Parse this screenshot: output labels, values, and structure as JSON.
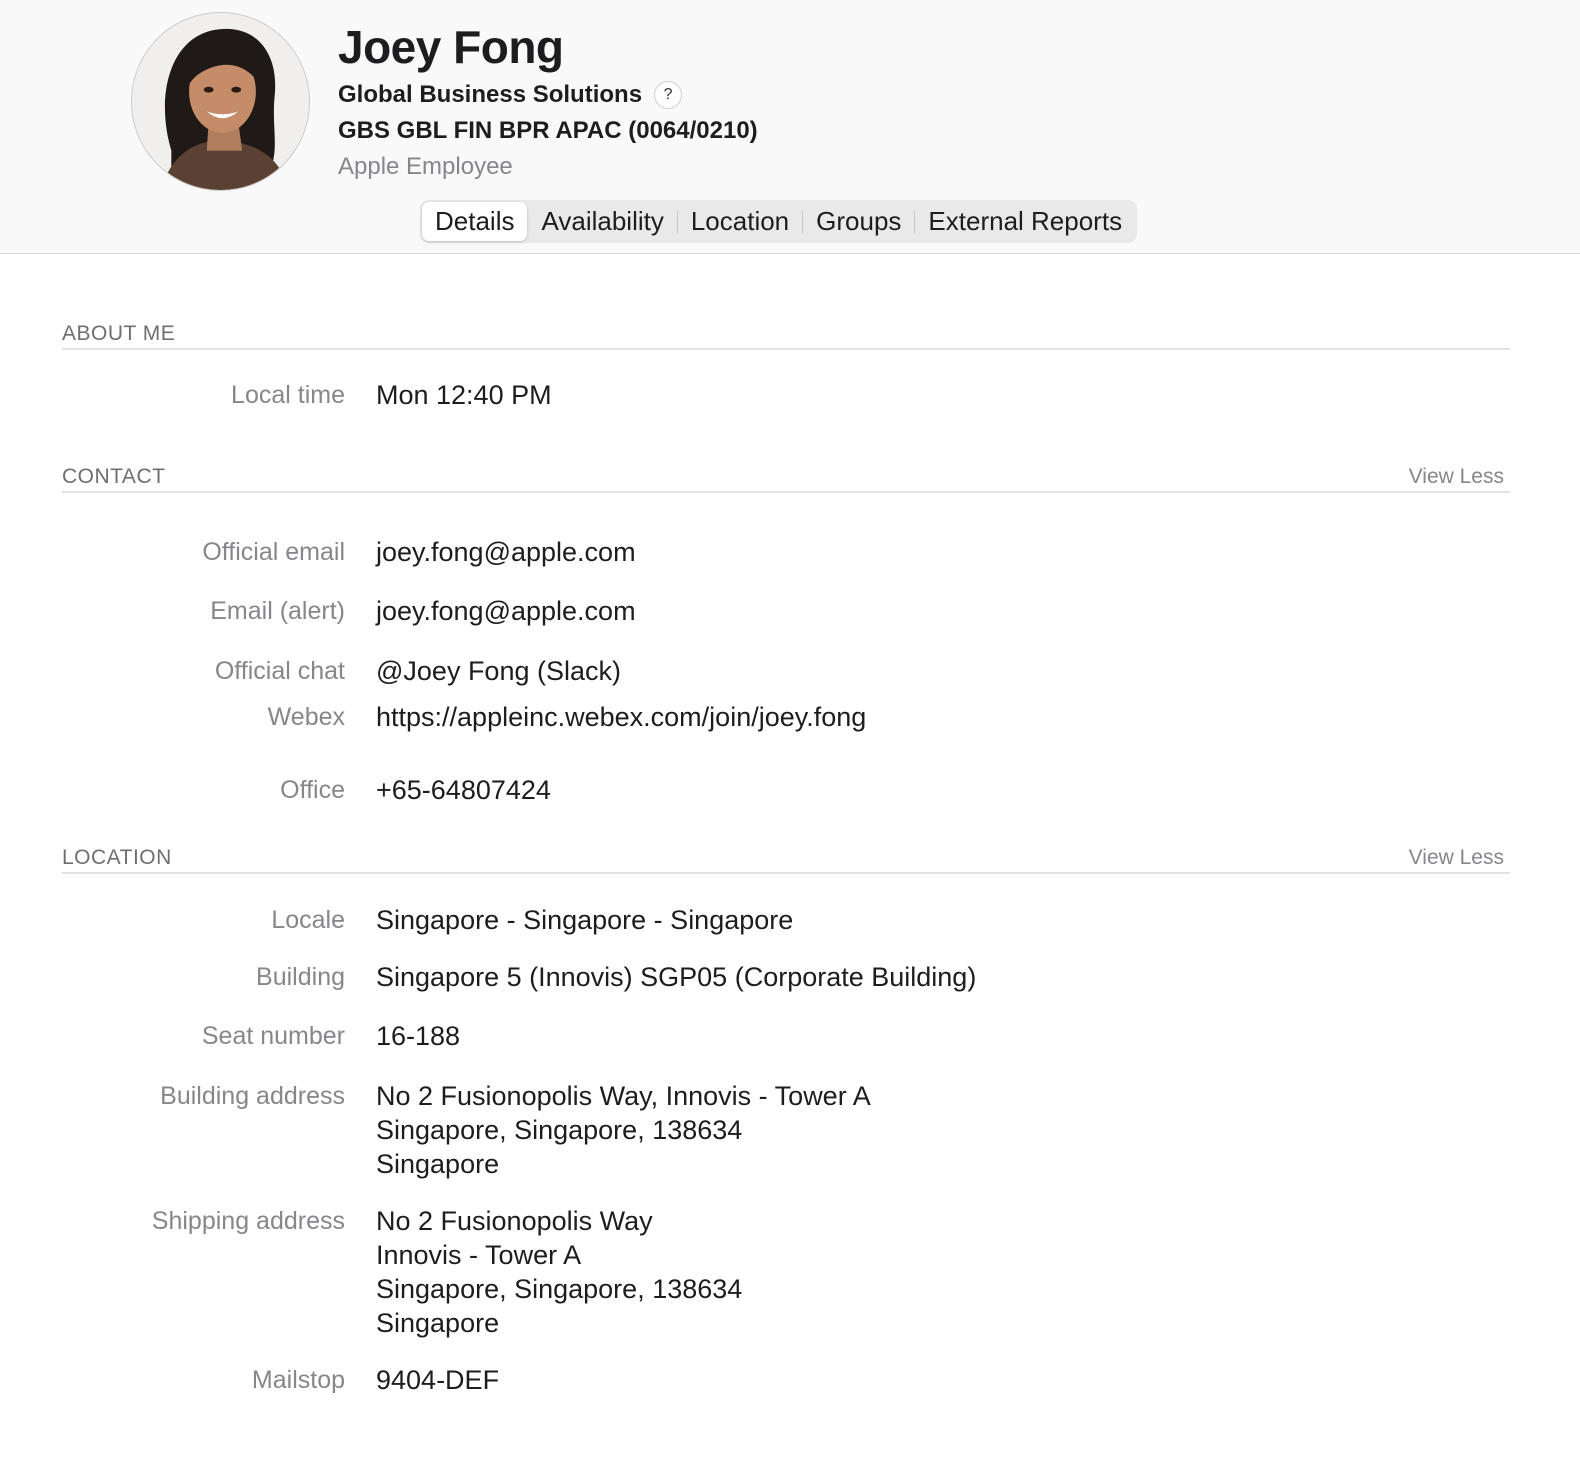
{
  "profile": {
    "name": "Joey Fong",
    "organization": "Global Business Solutions",
    "help_glyph": "?",
    "cost_center": "GBS GBL FIN BPR APAC (0064/0210)",
    "employee_type": "Apple Employee"
  },
  "tabs": [
    {
      "label": "Details",
      "active": true
    },
    {
      "label": "Availability",
      "active": false
    },
    {
      "label": "Location",
      "active": false
    },
    {
      "label": "Groups",
      "active": false
    },
    {
      "label": "External Reports",
      "active": false
    }
  ],
  "about": {
    "title": "ABOUT ME",
    "local_time_label": "Local time",
    "local_time": "Mon 12:40 PM"
  },
  "contact": {
    "title": "CONTACT",
    "view_less": "View Less",
    "official_email_label": "Official email",
    "official_email": "joey.fong@apple.com",
    "alert_email_label": "Email (alert)",
    "alert_email": "joey.fong@apple.com",
    "official_chat_label": "Official chat",
    "official_chat": "@Joey Fong (Slack)",
    "webex_label": "Webex",
    "webex": "https://appleinc.webex.com/join/joey.fong",
    "office_label": "Office",
    "office": "+65-64807424"
  },
  "location": {
    "title": "LOCATION",
    "view_less": "View Less",
    "locale_label": "Locale",
    "locale": "Singapore - Singapore - Singapore",
    "building_label": "Building",
    "building": "Singapore 5 (Innovis) SGP05 (Corporate Building)",
    "seat_label": "Seat number",
    "seat": "16-188",
    "building_address_label": "Building address",
    "building_address": [
      "No 2 Fusionopolis Way, Innovis - Tower A",
      "Singapore, Singapore, 138634",
      "Singapore"
    ],
    "shipping_address_label": "Shipping address",
    "shipping_address": [
      "No 2 Fusionopolis Way",
      "Innovis - Tower A",
      "Singapore, Singapore, 138634",
      "Singapore"
    ],
    "mailstop_label": "Mailstop",
    "mailstop": "9404-DEF"
  },
  "colors": {
    "header_bg": "#f9f9f9",
    "label_gray": "#86868b",
    "text": "#1d1d1f",
    "divider": "#e3e3e5"
  }
}
